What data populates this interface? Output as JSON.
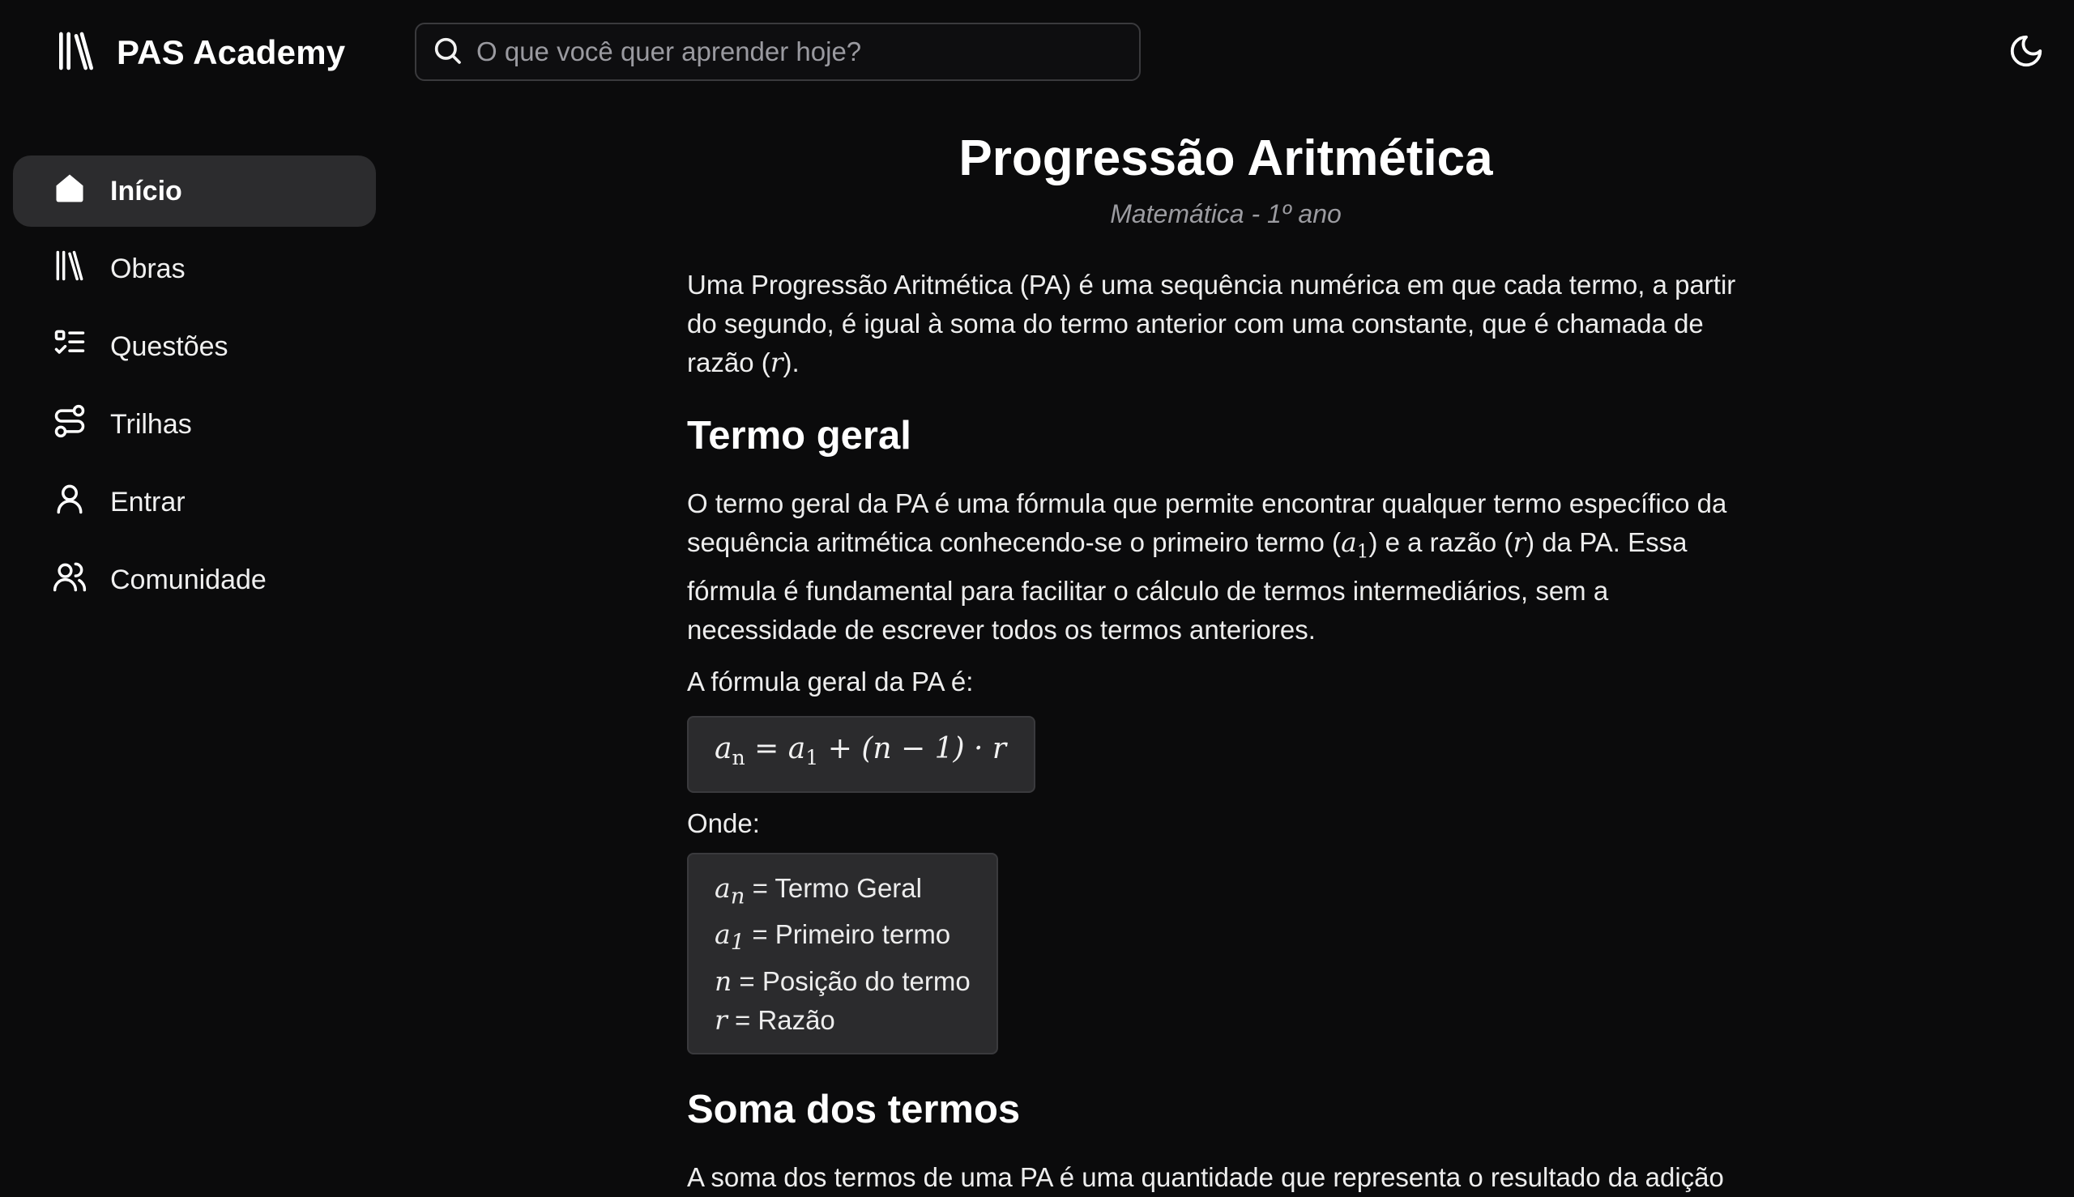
{
  "header": {
    "brand_name": "PAS Academy",
    "brand_icon": "library-icon",
    "search_placeholder": "O que você quer aprender hoje?",
    "search_value": "",
    "theme_icon": "moon-icon"
  },
  "sidebar": {
    "items": [
      {
        "label": "Início",
        "icon": "home-icon",
        "active": true
      },
      {
        "label": "Obras",
        "icon": "library-icon",
        "active": false
      },
      {
        "label": "Questões",
        "icon": "list-checks-icon",
        "active": false
      },
      {
        "label": "Trilhas",
        "icon": "route-icon",
        "active": false
      },
      {
        "label": "Entrar",
        "icon": "user-icon",
        "active": false
      },
      {
        "label": "Comunidade",
        "icon": "users-icon",
        "active": false
      }
    ]
  },
  "article": {
    "title": "Progressão Aritmética",
    "subtitle": "Matemática - 1º ano",
    "intro": {
      "before": "Uma Progressão Aritmética (PA) é uma sequência numérica em que cada termo, a partir do segundo, é igual à soma do termo anterior com uma constante, que é chamada de razão (",
      "math": "r",
      "after": ")."
    },
    "termo_geral": {
      "heading": "Termo geral",
      "p1": "O termo geral da PA é uma fórmula que permite encontrar qualquer termo específico da sequência aritmética conhecendo-se o primeiro termo (",
      "p1_math_a": "a",
      "p1_math_sub": "1",
      "p2": ") e a razão (",
      "p2_math": "r",
      "p3": ") da PA. Essa fórmula é fundamental para facilitar o cálculo de termos intermediários, sem a necessidade de escrever todos os termos anteriores.",
      "formula_intro": "A fórmula geral da PA é:",
      "formula": {
        "lhs": "a",
        "lhs_sub": "n",
        "eq": " = ",
        "a1": "a",
        "a1_sub": "1",
        "rest": " + (n − 1) · r"
      },
      "onde": "Onde:",
      "legend": [
        {
          "sym": "a",
          "sub": "n",
          "text": " = Termo Geral"
        },
        {
          "sym": "a",
          "sub": "1",
          "text": " = Primeiro termo"
        },
        {
          "sym": "n",
          "sub": "",
          "text": " = Posição do termo"
        },
        {
          "sym": "r",
          "sub": "",
          "text": " = Razão"
        }
      ]
    },
    "soma": {
      "heading": "Soma dos termos",
      "text": "A soma dos termos de uma PA é uma quantidade que representa o resultado da adição"
    }
  }
}
